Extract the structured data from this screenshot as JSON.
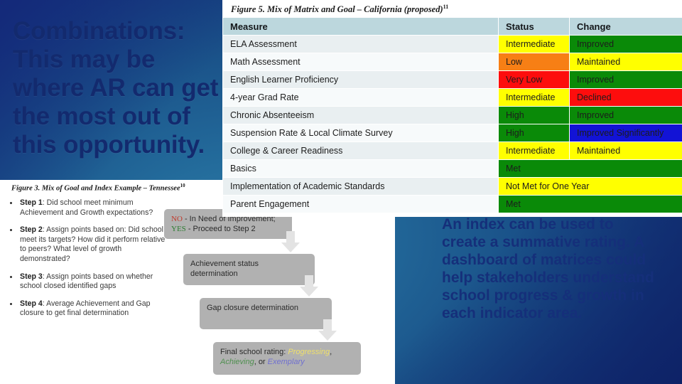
{
  "slide": {
    "headline": "Combinations: This may be where AR can get the most out of this opportunity.",
    "right_paragraph": "An index can be used to create a summative rating. A dashboard of matrices could help stakeholders understand school progress & growth in each indicator area."
  },
  "figure5": {
    "caption": "Figure 5. Mix of Matrix and Goal – California (proposed)",
    "caption_footnote": "11",
    "columns": [
      "Measure",
      "Status",
      "Change"
    ],
    "rows": [
      {
        "measure": "ELA Assessment",
        "status": "Intermediate",
        "status_color": "yellow",
        "change": "Improved",
        "change_color": "green"
      },
      {
        "measure": "Math Assessment",
        "status": "Low",
        "status_color": "orange",
        "change": "Maintained",
        "change_color": "yellow"
      },
      {
        "measure": "English Learner Proficiency",
        "status": "Very Low",
        "status_color": "red",
        "change": "Improved",
        "change_color": "green"
      },
      {
        "measure": "4-year Grad Rate",
        "status": "Intermediate",
        "status_color": "yellow",
        "change": "Declined",
        "change_color": "red"
      },
      {
        "measure": "Chronic Absenteeism",
        "status": "High",
        "status_color": "green",
        "change": "Improved",
        "change_color": "green"
      },
      {
        "measure": "Suspension Rate & Local Climate Survey",
        "status": "High",
        "status_color": "green",
        "change": "Improved Significantly",
        "change_color": "blue"
      },
      {
        "measure": "College & Career Readiness",
        "status": "Intermediate",
        "status_color": "yellow",
        "change": "Maintained",
        "change_color": "yellow"
      },
      {
        "measure": "Basics",
        "status": "Met",
        "status_color": "green",
        "change": "",
        "change_color": "green",
        "merged": true
      },
      {
        "measure": "Implementation of Academic Standards",
        "status": "Not Met for One Year",
        "status_color": "yellow",
        "change": "",
        "change_color": "yellow",
        "merged": true
      },
      {
        "measure": "Parent Engagement",
        "status": "Met",
        "status_color": "green",
        "change": "",
        "change_color": "green",
        "merged": true
      }
    ]
  },
  "figure3": {
    "caption": "Figure 3. Mix of Goal and Index Example – Tennessee",
    "caption_footnote": "10",
    "steps": [
      {
        "label": "Step 1",
        "text": ": Did school meet minimum Achievement and Growth expectations?"
      },
      {
        "label": "Step 2",
        "text": ": Assign points based on: Did school meet its targets? How did it perform relative to peers? What level of growth demonstrated?"
      },
      {
        "label": "Step 3",
        "text": ": Assign points based on whether school closed identified gaps"
      },
      {
        "label": "Step 4",
        "text": ": Average Achievement and Gap closure to get final determination"
      }
    ],
    "flow": {
      "box1_no": "NO",
      "box1_no_text": " - In Need of Improvement;",
      "box1_yes": "YES",
      "box1_yes_text": " - Proceed to Step 2",
      "box2": "Achievement status determination",
      "box3": "Gap closure determination",
      "box4_prefix": "Final school rating: ",
      "box4_w1": "Progressing",
      "box4_sep1": ", ",
      "box4_w2": "Achieving",
      "box4_sep2": ", or ",
      "box4_w3": "Exemplary"
    }
  },
  "colors": {
    "yellow": "#ffff00",
    "orange": "#f77f15",
    "red": "#fd0d0d",
    "green": "#0a8a08",
    "blue": "#1213d6",
    "header_fill": "#bcd7dd",
    "measure_fill": "#e9eff1",
    "slide_navy": "#132a6e",
    "slide_teal": "#2e7ca6"
  }
}
